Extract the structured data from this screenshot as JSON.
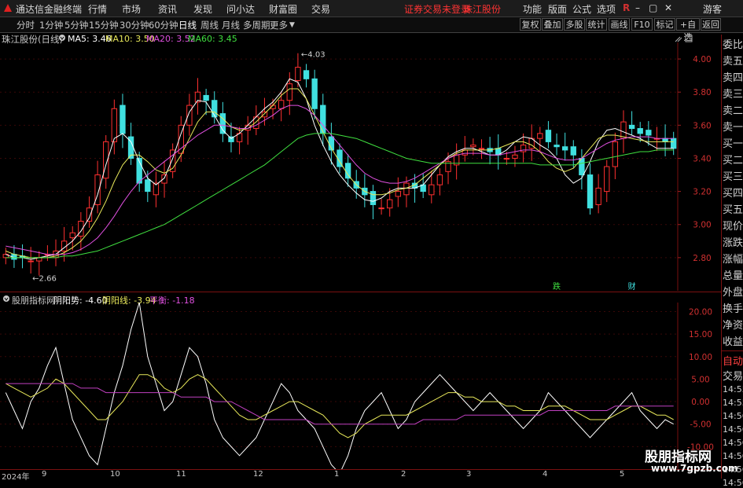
{
  "menubar": {
    "app_title": "通达信金融终端",
    "items": [
      "行情",
      "市场",
      "资讯",
      "发现",
      "问小达",
      "财富圈",
      "交易"
    ],
    "notice": "证券交易未登录",
    "stock_link": "珠江股份",
    "right_items": [
      "功能",
      "版面",
      "公式",
      "选项"
    ],
    "user": "游客",
    "colors": {
      "notice": "#ff3333",
      "logo": "#e02020"
    }
  },
  "toolbar": {
    "periods": [
      "分时",
      "1分钟",
      "5分钟",
      "15分钟",
      "30分钟",
      "60分钟",
      "日线",
      "周线",
      "月线",
      "多周期",
      "更多"
    ],
    "active_period": "日线",
    "buttons": [
      "复权",
      "叠加",
      "多股",
      "统计",
      "画线",
      "F10",
      "标记",
      "+自选",
      "返回"
    ]
  },
  "main_info": {
    "title": "珠江股份(日线)",
    "ma5": "MA5: 3.46",
    "ma10": "MA10: 3.50",
    "ma20": "MA20: 3.52",
    "ma60": "MA60: 3.45",
    "colors": {
      "ma5": "#ffffff",
      "ma10": "#e8e85a",
      "ma20": "#e050e0",
      "ma60": "#40e040"
    }
  },
  "price_axis": [
    "4.00",
    "3.80",
    "3.60",
    "3.40",
    "3.20",
    "3.00",
    "2.80"
  ],
  "annotations": {
    "high": "4.03",
    "low": "2.66",
    "mark1": "跌",
    "mark2": "财"
  },
  "sub_info": {
    "indicator_name": "股朋指标网",
    "yinyang": "阴阳势: -4.60",
    "yinyang_line": "阴阳线: -3.94",
    "balance": "平衡: -1.18"
  },
  "sub_axis": [
    "20.00",
    "15.00",
    "10.00",
    "5.00",
    "0.00",
    "-5.00",
    "-10.00"
  ],
  "date_axis": {
    "year": "2024年",
    "months": [
      "9",
      "10",
      "11",
      "12",
      "1",
      "2",
      "3",
      "4",
      "5"
    ]
  },
  "right_panel": {
    "items": [
      "委比",
      "卖五",
      "卖四",
      "卖三",
      "卖二",
      "卖一",
      "买一",
      "买二",
      "买三",
      "买四",
      "买五",
      "现价",
      "涨跌",
      "涨幅",
      "总量",
      "外盘",
      "换手",
      "净资",
      "收益"
    ],
    "sub_items": [
      "自动",
      "交易"
    ],
    "times": [
      "14:55",
      "14:55",
      "14:56",
      "14:56",
      "14:56",
      "14:56",
      "14:56",
      "14:56"
    ]
  },
  "watermark": {
    "logo": "股朋指标网",
    "url": "www.7gpzb.com"
  },
  "chart_data": {
    "type": "line",
    "title": "珠江股份(日线)",
    "ylim": [
      2.6,
      4.1
    ],
    "x": [
      "2024-09",
      "2024-10",
      "2024-11",
      "2024-12",
      "2025-01",
      "2025-02",
      "2025-03",
      "2025-04",
      "2025-05"
    ],
    "close": [
      2.82,
      2.79,
      2.8,
      2.78,
      2.8,
      2.82,
      2.84,
      2.9,
      2.95,
      3.02,
      3.1,
      3.3,
      3.5,
      3.7,
      3.55,
      3.4,
      3.25,
      3.2,
      3.25,
      3.3,
      3.45,
      3.6,
      3.72,
      3.8,
      3.75,
      3.65,
      3.55,
      3.5,
      3.55,
      3.6,
      3.65,
      3.68,
      3.72,
      3.75,
      3.85,
      3.95,
      3.88,
      3.7,
      3.55,
      3.45,
      3.35,
      3.28,
      3.22,
      3.18,
      3.12,
      3.1,
      3.15,
      3.2,
      3.25,
      3.22,
      3.2,
      3.24,
      3.3,
      3.38,
      3.42,
      3.45,
      3.48,
      3.46,
      3.44,
      3.42,
      3.4,
      3.42,
      3.48,
      3.52,
      3.55,
      3.5,
      3.47,
      3.45,
      3.42,
      3.3,
      3.1,
      3.22,
      3.35,
      3.5,
      3.62,
      3.58,
      3.55,
      3.54,
      3.52,
      3.5,
      3.46
    ],
    "series": [
      {
        "name": "MA5",
        "values": [
          2.82,
          2.8,
          2.8,
          2.79,
          2.8,
          2.81,
          2.82,
          2.86,
          2.9,
          2.96,
          3.04,
          3.18,
          3.36,
          3.52,
          3.55,
          3.5,
          3.38,
          3.28,
          3.24,
          3.28,
          3.4,
          3.55,
          3.68,
          3.75,
          3.74,
          3.66,
          3.57,
          3.52,
          3.55,
          3.6,
          3.65,
          3.7,
          3.74,
          3.8,
          3.88,
          3.86,
          3.76,
          3.6,
          3.48,
          3.38,
          3.3,
          3.24,
          3.19,
          3.15,
          3.14,
          3.16,
          3.2,
          3.22,
          3.22,
          3.22,
          3.24,
          3.3,
          3.36,
          3.41,
          3.44,
          3.46,
          3.46,
          3.44,
          3.42,
          3.42,
          3.45,
          3.5,
          3.53,
          3.52,
          3.48,
          3.45,
          3.4,
          3.3,
          3.25,
          3.28,
          3.38,
          3.5,
          3.57,
          3.58,
          3.56,
          3.54,
          3.52,
          3.49,
          3.46,
          3.46,
          3.46
        ]
      },
      {
        "name": "MA10",
        "values": [
          2.84,
          2.82,
          2.81,
          2.8,
          2.8,
          2.8,
          2.81,
          2.83,
          2.86,
          2.9,
          2.96,
          3.04,
          3.14,
          3.26,
          3.36,
          3.42,
          3.42,
          3.38,
          3.33,
          3.31,
          3.34,
          3.42,
          3.52,
          3.62,
          3.68,
          3.68,
          3.64,
          3.59,
          3.57,
          3.58,
          3.62,
          3.67,
          3.72,
          3.78,
          3.82,
          3.82,
          3.76,
          3.66,
          3.56,
          3.46,
          3.38,
          3.3,
          3.24,
          3.2,
          3.18,
          3.18,
          3.19,
          3.21,
          3.22,
          3.24,
          3.28,
          3.32,
          3.36,
          3.4,
          3.43,
          3.45,
          3.45,
          3.45,
          3.45,
          3.46,
          3.48,
          3.5,
          3.5,
          3.48,
          3.44,
          3.38,
          3.34,
          3.32,
          3.34,
          3.4,
          3.46,
          3.52,
          3.54,
          3.54,
          3.53,
          3.52,
          3.51,
          3.5,
          3.5,
          3.5,
          3.5
        ]
      },
      {
        "name": "MA20",
        "values": [
          2.87,
          2.86,
          2.85,
          2.84,
          2.83,
          2.82,
          2.82,
          2.82,
          2.83,
          2.85,
          2.88,
          2.92,
          2.98,
          3.05,
          3.13,
          3.2,
          3.26,
          3.3,
          3.34,
          3.38,
          3.42,
          3.46,
          3.5,
          3.54,
          3.57,
          3.6,
          3.6,
          3.59,
          3.58,
          3.58,
          3.6,
          3.63,
          3.66,
          3.7,
          3.72,
          3.72,
          3.7,
          3.66,
          3.6,
          3.54,
          3.48,
          3.42,
          3.36,
          3.31,
          3.28,
          3.26,
          3.25,
          3.25,
          3.26,
          3.28,
          3.31,
          3.34,
          3.37,
          3.4,
          3.42,
          3.43,
          3.43,
          3.43,
          3.42,
          3.42,
          3.43,
          3.44,
          3.45,
          3.45,
          3.44,
          3.42,
          3.4,
          3.39,
          3.39,
          3.4,
          3.43,
          3.46,
          3.49,
          3.51,
          3.52,
          3.53,
          3.53,
          3.53,
          3.52,
          3.52,
          3.52
        ]
      },
      {
        "name": "MA60",
        "values": [
          2.8,
          2.8,
          2.8,
          2.8,
          2.8,
          2.8,
          2.8,
          2.81,
          2.81,
          2.82,
          2.83,
          2.84,
          2.86,
          2.88,
          2.9,
          2.92,
          2.94,
          2.96,
          2.98,
          3.0,
          3.03,
          3.06,
          3.09,
          3.12,
          3.15,
          3.18,
          3.21,
          3.24,
          3.27,
          3.3,
          3.33,
          3.36,
          3.4,
          3.44,
          3.48,
          3.52,
          3.54,
          3.55,
          3.55,
          3.55,
          3.54,
          3.53,
          3.52,
          3.5,
          3.48,
          3.46,
          3.44,
          3.42,
          3.4,
          3.39,
          3.38,
          3.37,
          3.37,
          3.37,
          3.37,
          3.37,
          3.37,
          3.37,
          3.37,
          3.37,
          3.37,
          3.37,
          3.37,
          3.37,
          3.36,
          3.36,
          3.36,
          3.36,
          3.36,
          3.37,
          3.38,
          3.39,
          3.4,
          3.41,
          3.42,
          3.43,
          3.44,
          3.44,
          3.45,
          3.45,
          3.45
        ]
      }
    ],
    "sub_chart": {
      "ylim": [
        -15,
        22
      ],
      "series": [
        {
          "name": "阴阳势",
          "values": [
            2,
            -2,
            -6,
            0,
            3,
            8,
            12,
            4,
            -4,
            -8,
            -12,
            -14,
            -6,
            2,
            8,
            16,
            22,
            10,
            4,
            -2,
            0,
            6,
            12,
            10,
            4,
            -4,
            -8,
            -10,
            -12,
            -10,
            -8,
            -4,
            0,
            4,
            2,
            -2,
            -4,
            -6,
            -10,
            -14,
            -16,
            -12,
            -6,
            -2,
            0,
            2,
            -2,
            -6,
            -4,
            0,
            2,
            4,
            6,
            4,
            2,
            0,
            -2,
            0,
            2,
            0,
            -2,
            -4,
            -6,
            -4,
            -2,
            2,
            0,
            -2,
            -4,
            -6,
            -8,
            -6,
            -4,
            -2,
            0,
            2,
            -2,
            -4,
            -6,
            -4,
            -5
          ]
        },
        {
          "name": "阴阳线",
          "values": [
            4,
            3,
            2,
            1,
            2,
            3,
            5,
            4,
            2,
            0,
            -2,
            -4,
            -4,
            -2,
            0,
            3,
            6,
            6,
            5,
            3,
            2,
            3,
            5,
            6,
            5,
            3,
            1,
            -1,
            -3,
            -4,
            -4,
            -3,
            -2,
            -1,
            0,
            0,
            -1,
            -2,
            -3,
            -5,
            -7,
            -8,
            -7,
            -5,
            -4,
            -3,
            -3,
            -3,
            -3,
            -2,
            -1,
            0,
            1,
            2,
            2,
            1,
            1,
            0,
            0,
            0,
            -1,
            -1,
            -2,
            -2,
            -2,
            -1,
            -1,
            -1,
            -2,
            -3,
            -4,
            -4,
            -4,
            -3,
            -2,
            -1,
            -1,
            -2,
            -3,
            -3,
            -4
          ]
        },
        {
          "name": "平衡",
          "values": [
            4,
            4,
            4,
            4,
            4,
            4,
            4,
            4,
            4,
            3,
            3,
            3,
            2,
            2,
            2,
            2,
            2,
            2,
            2,
            2,
            2,
            1,
            1,
            1,
            1,
            0,
            0,
            0,
            -1,
            -2,
            -3,
            -4,
            -4,
            -4,
            -4,
            -4,
            -4,
            -5,
            -5,
            -5,
            -5,
            -5,
            -5,
            -5,
            -5,
            -5,
            -5,
            -5,
            -5,
            -5,
            -4,
            -4,
            -4,
            -4,
            -4,
            -3,
            -3,
            -3,
            -3,
            -3,
            -3,
            -3,
            -3,
            -3,
            -3,
            -2,
            -2,
            -2,
            -2,
            -2,
            -2,
            -2,
            -2,
            -1,
            -1,
            -1,
            -1,
            -1,
            -1,
            -1,
            -1
          ]
        }
      ]
    }
  }
}
